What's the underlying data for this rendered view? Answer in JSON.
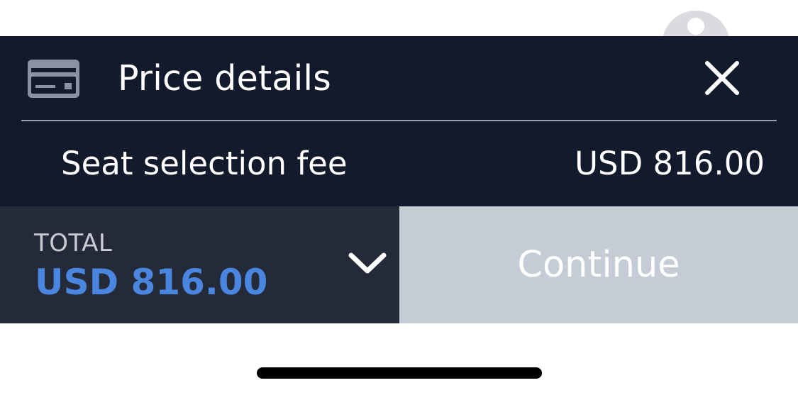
{
  "header": {
    "title": "Price details",
    "icon": "credit-card-icon",
    "close_icon": "close-icon"
  },
  "fee": {
    "label": "Seat selection fee",
    "amount": "USD 816.00"
  },
  "footer": {
    "total_label": "TOTAL",
    "total_amount": "USD 816.00",
    "expand_icon": "chevron-down-icon",
    "continue_label": "Continue"
  },
  "colors": {
    "sheet_background": "#131a2b",
    "total_panel_background": "#242a38",
    "total_amount_accent": "#4a86e0",
    "continue_button_disabled": "#c6ccd6"
  }
}
